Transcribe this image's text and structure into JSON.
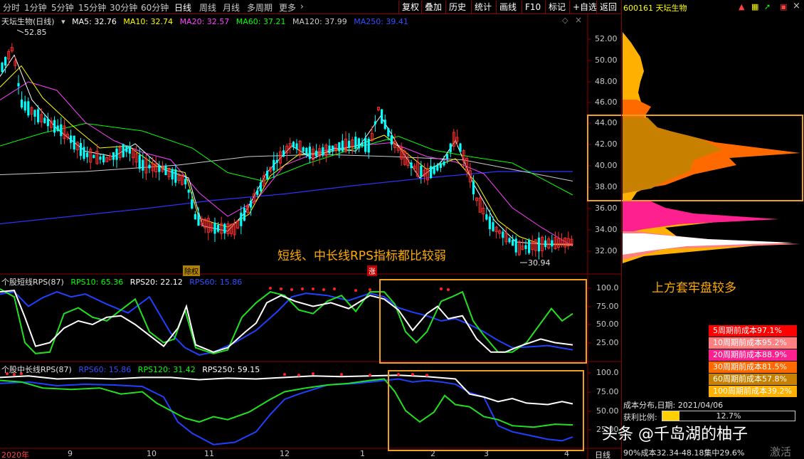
{
  "toolbar": {
    "period_tabs": [
      "分时",
      "1分钟",
      "5分钟",
      "15分钟",
      "30分钟",
      "60分钟",
      "日线",
      "周线",
      "月线",
      "多周期",
      "更多"
    ],
    "active_tab": "日线",
    "right_buttons": [
      "复权",
      "叠加",
      "历史",
      "统计",
      "画线",
      "F10",
      "标记",
      "+自选",
      "返回"
    ]
  },
  "stock": {
    "code": "600161",
    "name": "天坛生物"
  },
  "main_title": {
    "label": "天坛生物(日线)",
    "ma5": "MA5: 32.76",
    "ma10": "MA10: 32.74",
    "ma20": "MA20: 32.57",
    "ma60": "MA60: 37.21",
    "ma120": "MA120: 37.99",
    "ma250": "MA250: 39.41"
  },
  "price_axis": [
    "52.00",
    "50.00",
    "48.00",
    "46.00",
    "44.00",
    "42.00",
    "40.00",
    "38.00",
    "36.00",
    "34.00",
    "32.00"
  ],
  "markers": {
    "high": "52.85",
    "low": "30.94",
    "tag1": "除权",
    "tag2": "涨"
  },
  "rps_short_title": {
    "label": "个股短线RPS(87)",
    "rps10": "RPS10: 65.36",
    "rps20": "RPS20: 22.12",
    "rps60": "RPS60: 15.86"
  },
  "rps_long_title": {
    "label": "个股中长线RPS(87)",
    "rps60": "RPS60: 15.86",
    "rps120": "RPS120: 31.42",
    "rps250": "RPS250: 59.15"
  },
  "rps_axis": [
    "100.0",
    "75.00",
    "50.00",
    "25.00"
  ],
  "date_axis": [
    "2020年",
    "9",
    "10",
    "11",
    "12",
    "1",
    "2",
    "3",
    "4"
  ],
  "period_label": "日线",
  "annotations": {
    "chart_note": "短线、中长线RPS指标都比较弱",
    "chip_note": "上方套牢盘较多"
  },
  "chip_legend": [
    {
      "label": "5周期前成本97.1%",
      "color": "#ff0000"
    },
    {
      "label": "10周期前成本95.2%",
      "color": "#ff8080"
    },
    {
      "label": "20周期前成本88.9%",
      "color": "#ff2090"
    },
    {
      "label": "30周期前成本81.5%",
      "color": "#ff6a00"
    },
    {
      "label": "60周期前成本57.8%",
      "color": "#c88000"
    },
    {
      "label": "100周期前成本39.2%",
      "color": "#ffb000"
    }
  ],
  "chip_info": {
    "date": "成本分布,日期: 2021/04/06",
    "profit_label": "获利比例:",
    "profit_value": "12.7%",
    "range": "90%成本32.34-48.18集中29.6%",
    "watermark": "激活"
  },
  "watermark": "头条 @千岛湖的柚子",
  "colors": {
    "ma5": "#ffffff",
    "ma10": "#ffff00",
    "ma20": "#ff40ff",
    "ma60": "#00ff00",
    "ma120": "#cccccc",
    "ma250": "#3030ff",
    "up": "#ff3030",
    "down": "#00ffff",
    "highlight": "#f0a020"
  }
}
